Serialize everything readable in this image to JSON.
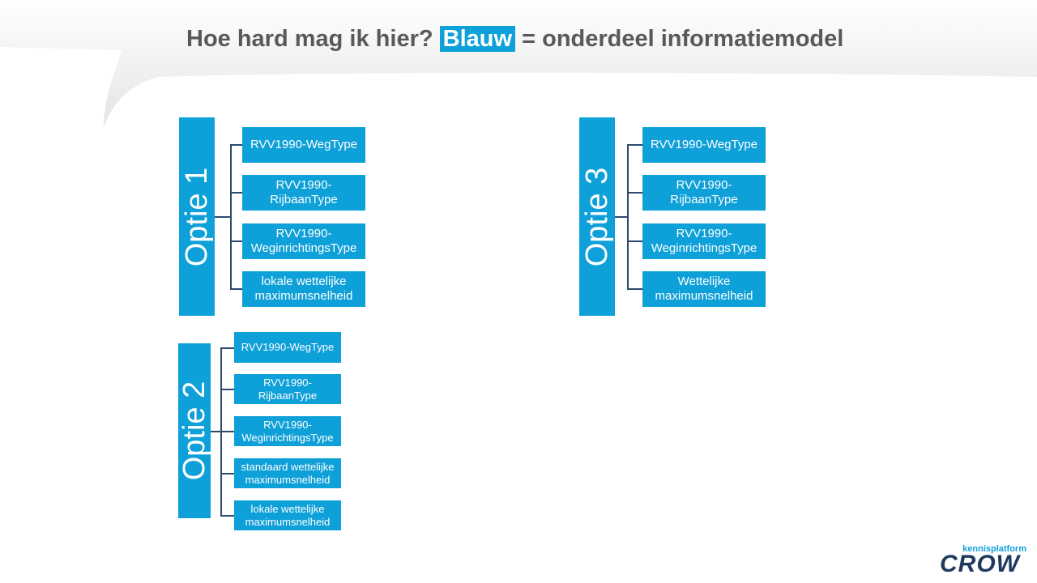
{
  "title": {
    "prefix": "Hoe hard mag ik hier?",
    "highlight": "Blauw",
    "suffix": "= onderdeel informatiemodel"
  },
  "options": [
    {
      "label": "Optie 1",
      "items": [
        "RVV1990-WegType",
        "RVV1990-\nRijbaanType",
        "RVV1990-\nWeginrichtingsType",
        "lokale wettelijke\nmaximumsnelheid"
      ]
    },
    {
      "label": "Optie 2",
      "items": [
        "RVV1990-WegType",
        "RVV1990-\nRijbaanType",
        "RVV1990-\nWeginrichtingsType",
        "standaard wettelijke\nmaximumsnelheid",
        "lokale wettelijke\nmaximumsnelheid"
      ]
    },
    {
      "label": "Optie 3",
      "items": [
        "RVV1990-WegType",
        "RVV1990-\nRijbaanType",
        "RVV1990-\nWeginrichtingsType",
        "Wettelijke\nmaximumsnelheid"
      ]
    }
  ],
  "logo": {
    "small": "kennisplatform",
    "big": "CROW"
  },
  "colors": {
    "accent": "#0ea0d8",
    "connector": "#2c4a6e",
    "title_text": "#595959"
  }
}
